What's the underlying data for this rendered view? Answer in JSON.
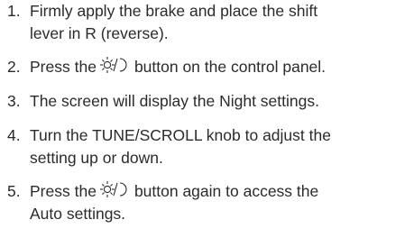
{
  "steps": [
    {
      "number": "1.",
      "line1": "Firmly apply the brake and place the shift",
      "line2": "lever in R (reverse)."
    },
    {
      "number": "2.",
      "before_icon": "Press the",
      "icon": "sun-moon-icon",
      "after_icon": "button on the control panel."
    },
    {
      "number": "3.",
      "text": "The screen will display the Night settings."
    },
    {
      "number": "4.",
      "line1": "Turn the TUNE/SCROLL knob to adjust the",
      "line2": "setting up or down."
    },
    {
      "number": "5.",
      "before_icon": "Press the",
      "icon": "sun-moon-icon",
      "after_icon": "button again to access the",
      "line2": "Auto settings."
    }
  ]
}
